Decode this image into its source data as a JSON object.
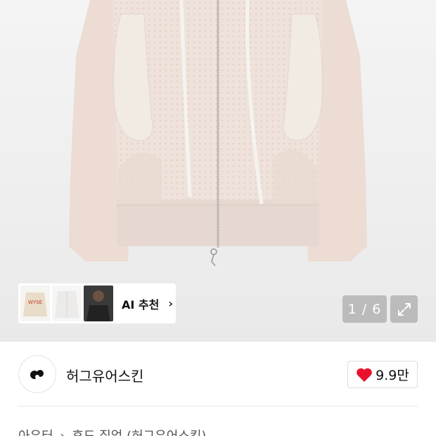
{
  "gallery": {
    "ai_recommend_label": "AI 추천",
    "ai_chevron": "›",
    "counter": "1 / 6",
    "thumbnails": [
      {
        "label": "WYSE"
      },
      {
        "label": ""
      },
      {
        "label": ""
      }
    ]
  },
  "brand": {
    "name": "허그유어스킨",
    "logo_text": "hugyourskin",
    "like_count": "9.9만",
    "heart_color": "#e8112d"
  },
  "breadcrumb": {
    "items": [
      "아우터",
      "›",
      "후드 집업 (허그유어스킨)"
    ]
  },
  "colors": {
    "hoodie": "#efe1da",
    "accent": "#e8112d"
  }
}
